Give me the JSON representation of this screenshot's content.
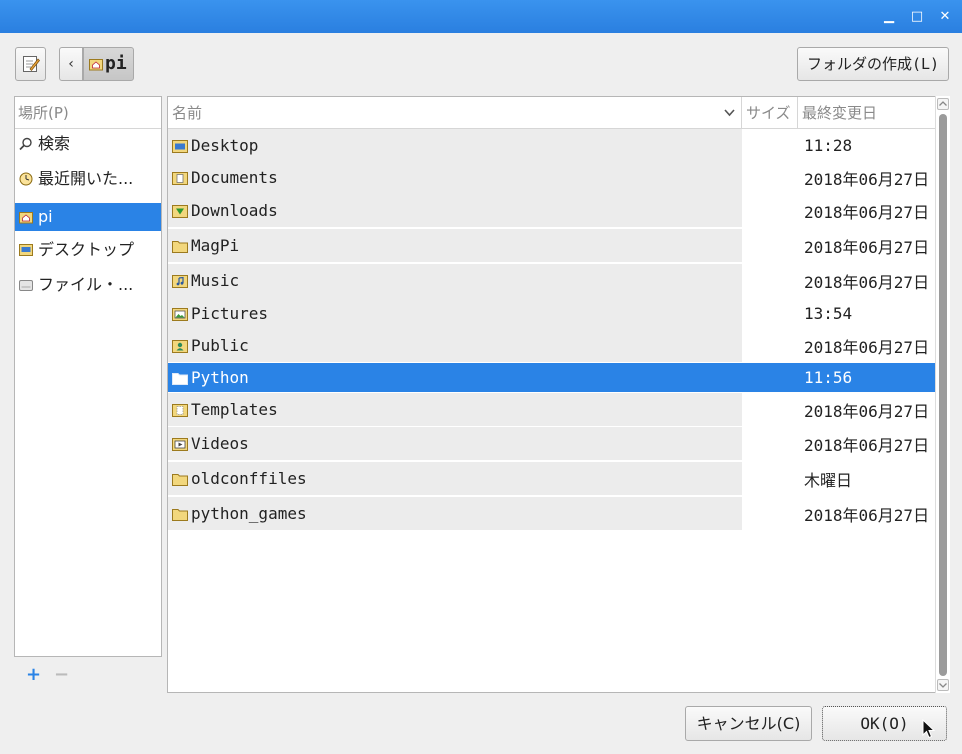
{
  "window": {
    "minimize_glyph": "▁",
    "maximize_glyph": "□",
    "close_glyph": "✕"
  },
  "toolbar": {
    "back_glyph": "‹",
    "current_folder": "pi",
    "new_folder_label": "フォルダの作成(L)"
  },
  "places": {
    "header": "場所(P)",
    "items": [
      {
        "label": "検索",
        "icon": "search-icon",
        "selected": false
      },
      {
        "label": "最近開いた...",
        "icon": "recent-icon",
        "selected": false
      },
      {
        "label": "pi",
        "icon": "home-folder-icon",
        "selected": true
      },
      {
        "label": "デスクトップ",
        "icon": "desktop-icon",
        "selected": false
      },
      {
        "label": "ファイル・...",
        "icon": "drive-icon",
        "selected": false
      }
    ],
    "add_glyph": "+",
    "remove_glyph": "−"
  },
  "files": {
    "columns": {
      "name": "名前",
      "size": "サイズ",
      "modified": "最終変更日"
    },
    "rows": [
      {
        "name": "Desktop",
        "modified": "11:28",
        "icon": "desktop-folder-icon",
        "selected": false
      },
      {
        "name": "Documents",
        "modified": "2018年06月27日",
        "icon": "documents-folder-icon",
        "selected": false
      },
      {
        "name": "Downloads",
        "modified": "2018年06月27日",
        "icon": "downloads-folder-icon",
        "selected": false
      },
      {
        "name": "MagPi",
        "modified": "2018年06月27日",
        "icon": "folder-icon",
        "selected": false
      },
      {
        "name": "Music",
        "modified": "2018年06月27日",
        "icon": "music-folder-icon",
        "selected": false
      },
      {
        "name": "Pictures",
        "modified": "13:54",
        "icon": "pictures-folder-icon",
        "selected": false
      },
      {
        "name": "Public",
        "modified": "2018年06月27日",
        "icon": "public-folder-icon",
        "selected": false
      },
      {
        "name": "Python",
        "modified": "11:56",
        "icon": "folder-icon",
        "selected": true
      },
      {
        "name": "Templates",
        "modified": "2018年06月27日",
        "icon": "templates-folder-icon",
        "selected": false
      },
      {
        "name": "Videos",
        "modified": "2018年06月27日",
        "icon": "videos-folder-icon",
        "selected": false
      },
      {
        "name": "oldconffiles",
        "modified": "木曜日",
        "icon": "folder-icon",
        "selected": false
      },
      {
        "name": "python_games",
        "modified": "2018年06月27日",
        "icon": "folder-icon",
        "selected": false
      }
    ]
  },
  "footer": {
    "cancel_label": "キャンセル(C)",
    "ok_label": "OK(O)"
  },
  "colors": {
    "accent": "#2a83e6",
    "titlebar": "#2a7fe0",
    "folder": "#f2d77d"
  }
}
